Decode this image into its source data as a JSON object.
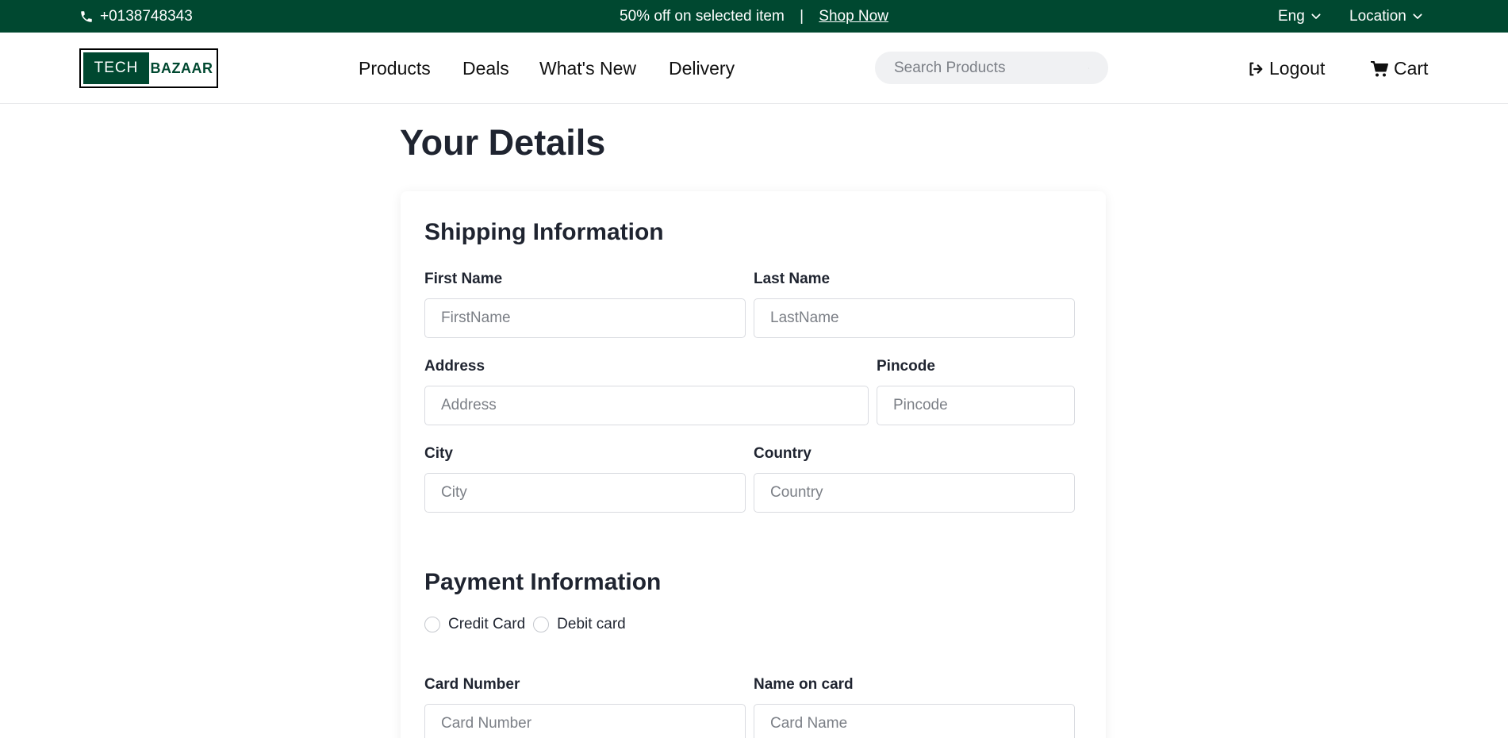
{
  "topbar": {
    "phone": "+0138748343",
    "promo_text": "50% off on selected item",
    "promo_separator": "|",
    "promo_link": "Shop Now",
    "language": "Eng",
    "location": "Location"
  },
  "brand": {
    "part1": "TECH",
    "part2": "BAZAAR",
    "color": "#004830"
  },
  "nav": {
    "items": [
      "Products",
      "Deals",
      "What's New",
      "Delivery"
    ]
  },
  "search": {
    "placeholder": "Search Products"
  },
  "header_links": {
    "logout": "Logout",
    "cart": "Cart"
  },
  "page": {
    "title": "Your Details"
  },
  "shipping": {
    "title": "Shipping Information",
    "first_name": {
      "label": "First Name",
      "placeholder": "FirstName"
    },
    "last_name": {
      "label": "Last Name",
      "placeholder": "LastName"
    },
    "address": {
      "label": "Address",
      "placeholder": "Address"
    },
    "pincode": {
      "label": "Pincode",
      "placeholder": "Pincode"
    },
    "city": {
      "label": "City",
      "placeholder": "City"
    },
    "country": {
      "label": "Country",
      "placeholder": "Country"
    }
  },
  "payment": {
    "title": "Payment Information",
    "options": [
      "Credit Card",
      "Debit card"
    ],
    "card_number": {
      "label": "Card Number",
      "placeholder": "Card Number"
    },
    "name_on_card": {
      "label": "Name on card",
      "placeholder": "Card Name"
    }
  },
  "icons": {
    "phone": "phone-icon",
    "chevron": "chevron-down-icon",
    "search": "search-icon",
    "logout": "logout-icon",
    "cart": "cart-icon"
  }
}
